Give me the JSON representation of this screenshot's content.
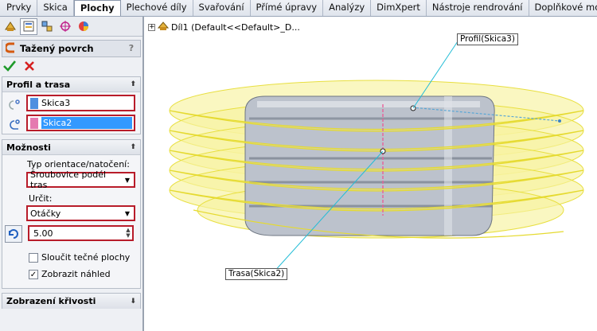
{
  "tabs": [
    "Prvky",
    "Skica",
    "Plochy",
    "Plechové díly",
    "Svařování",
    "Přímé úpravy",
    "Analýzy",
    "DimXpert",
    "Nástroje rendrování",
    "Doplňkové moduly SC"
  ],
  "active_tab": "Plochy",
  "panel": {
    "feature_title": "Tažený povrch",
    "help_label": "?",
    "profile_section": {
      "title": "Profil a trasa",
      "profile_value": "Skica3",
      "profile_color": "#4f8fe0",
      "path_value": "Skica2",
      "path_color": "#e57ab0"
    },
    "options_section": {
      "title": "Možnosti",
      "orientation_label": "Typ orientace/natočení:",
      "orientation_value": "Šroubovice podél tras",
      "specify_label": "Určit:",
      "specify_value": "Otáčky",
      "turns_value": "5.00",
      "merge_tangent_label": "Sloučit tečné plochy",
      "merge_tangent_checked": false,
      "show_preview_label": "Zobrazit náhled",
      "show_preview_checked": true
    },
    "curve_display_section": {
      "title": "Zobrazení křivosti"
    }
  },
  "viewport": {
    "tree_item": "Díl1  (Default<<Default>_D...",
    "profile_callout": "Profil(Skica3)",
    "path_callout": "Trasa(Skica2)",
    "helix_color": "#f5ee6a",
    "body_color": "#b6bcc6"
  },
  "colors": {
    "highlight_border": "#b81c2a",
    "selected_field": "#3399ff"
  }
}
